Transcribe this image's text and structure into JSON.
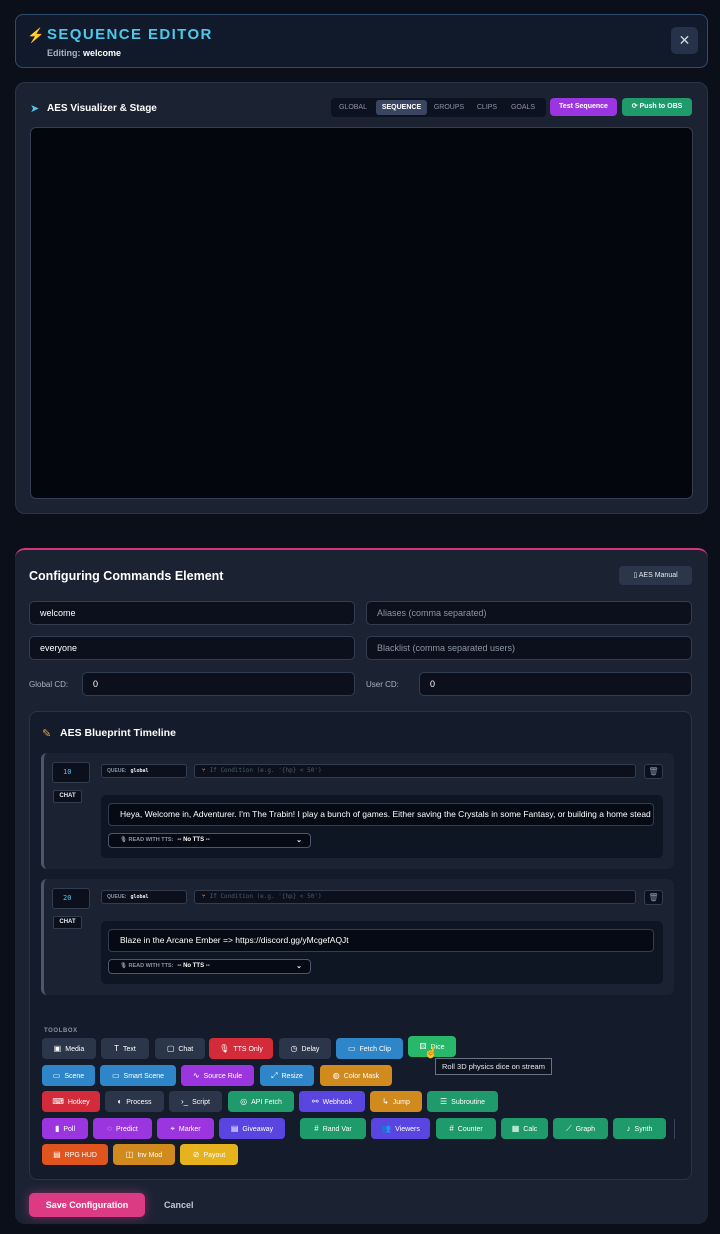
{
  "header": {
    "title": "SEQUENCE EDITOR",
    "editing_label": "Editing:",
    "editing_value": "welcome"
  },
  "stage": {
    "title": "AES Visualizer & Stage",
    "tabs": [
      "GLOBAL",
      "SEQUENCE",
      "GROUPS",
      "CLIPS",
      "GOALS"
    ],
    "active_tab": "SEQUENCE",
    "test_button": "Test Sequence",
    "push_button": "Push to OBS"
  },
  "config": {
    "title": "Configuring Commands Element",
    "manual_button": "AES Manual",
    "name_value": "welcome",
    "aliases_placeholder": "Aliases (comma separated)",
    "permission_value": "everyone",
    "blacklist_placeholder": "Blacklist (comma separated users)",
    "global_cd_label": "Global CD:",
    "global_cd_value": "0",
    "user_cd_label": "User CD:",
    "user_cd_value": "0"
  },
  "timeline": {
    "title": "AES Blueprint Timeline",
    "queue_label": "QUEUE:",
    "condition_placeholder": "If Condition (e.g. '{hp} < 50')",
    "tts_label": "READ WITH TTS:",
    "steps": [
      {
        "order": "10",
        "type": "CHAT",
        "queue": "global",
        "message": "Heya, Welcome in, Adventurer. I'm The Trabin! I play a bunch of games. Either saving the Crystals in some Fantasy, or building a home stead i",
        "tts": "-- No TTS --"
      },
      {
        "order": "20",
        "type": "CHAT",
        "queue": "global",
        "message": "Blaze in the Arcane Ember => https://discord.gg/yMcgefAQJt",
        "tts": "-- No TTS --"
      }
    ]
  },
  "toolbox": {
    "label": "TOOLBOX",
    "tooltip": "Roll 3D physics dice on stream",
    "buttons": [
      {
        "label": "Media",
        "icon": "image-icon",
        "color": "#2c364a"
      },
      {
        "label": "Text",
        "icon": "text-icon",
        "color": "#2c364a"
      },
      {
        "label": "Chat",
        "icon": "chat-icon",
        "color": "#2c364a"
      },
      {
        "label": "TTS Only",
        "icon": "mic-icon",
        "color": "#d42b3a"
      },
      {
        "label": "Delay",
        "icon": "clock-icon",
        "color": "#2c364a"
      },
      {
        "label": "Fetch Clip",
        "icon": "video-icon",
        "color": "#2e86c8"
      },
      {
        "label": "Dice",
        "icon": "dice-icon",
        "color": "#27b86a"
      },
      {
        "label": "Scene",
        "icon": "monitor-icon",
        "color": "#2e86c8"
      },
      {
        "label": "Smart Scene",
        "icon": "smart-monitor-icon",
        "color": "#2e86c8"
      },
      {
        "label": "Source Rule",
        "icon": "pulse-icon",
        "color": "#9b35e0"
      },
      {
        "label": "Resize",
        "icon": "resize-icon",
        "color": "#2e86c8"
      },
      {
        "label": "Color Mask",
        "icon": "palette-icon",
        "color": "#d08a1e"
      },
      {
        "label": "Hotkey",
        "icon": "keyboard-icon",
        "color": "#d42b3a"
      },
      {
        "label": "Process",
        "icon": "toggle-icon",
        "color": "#2c364a"
      },
      {
        "label": "Script",
        "icon": "terminal-icon",
        "color": "#2c364a"
      },
      {
        "label": "API Fetch",
        "icon": "globe-icon",
        "color": "#1f9a6a"
      },
      {
        "label": "Webhook",
        "icon": "webhook-icon",
        "color": "#5a45e0"
      },
      {
        "label": "Jump",
        "icon": "jump-icon",
        "color": "#d08a1e"
      },
      {
        "label": "Subroutine",
        "icon": "list-icon",
        "color": "#1f9a6a"
      },
      {
        "label": "Poll",
        "icon": "bar-chart-icon",
        "color": "#9b35e0"
      },
      {
        "label": "Predict",
        "icon": "bulb-icon",
        "color": "#9b35e0"
      },
      {
        "label": "Marker",
        "icon": "marker-icon",
        "color": "#9b35e0"
      },
      {
        "label": "Giveaway",
        "icon": "gift-icon",
        "color": "#5a45e0"
      },
      {
        "label": "Rand Var",
        "icon": "hash-icon",
        "color": "#1f9a6a"
      },
      {
        "label": "Viewers",
        "icon": "users-icon",
        "color": "#5a45e0"
      },
      {
        "label": "Counter",
        "icon": "hash-icon",
        "color": "#1f9a6a"
      },
      {
        "label": "Calc",
        "icon": "calculator-icon",
        "color": "#1f9a6a"
      },
      {
        "label": "Graph",
        "icon": "line-chart-icon",
        "color": "#1f9a6a"
      },
      {
        "label": "Synth",
        "icon": "music-icon",
        "color": "#1f9a6a"
      },
      {
        "label": "RPG HUD",
        "icon": "hud-icon",
        "color": "#e0541e"
      },
      {
        "label": "Inv Mod",
        "icon": "box-icon",
        "color": "#d08a1e"
      },
      {
        "label": "Payout",
        "icon": "coin-icon",
        "color": "#e6b21e"
      }
    ]
  },
  "footer": {
    "save_button": "Save Configuration",
    "cancel_button": "Cancel"
  }
}
